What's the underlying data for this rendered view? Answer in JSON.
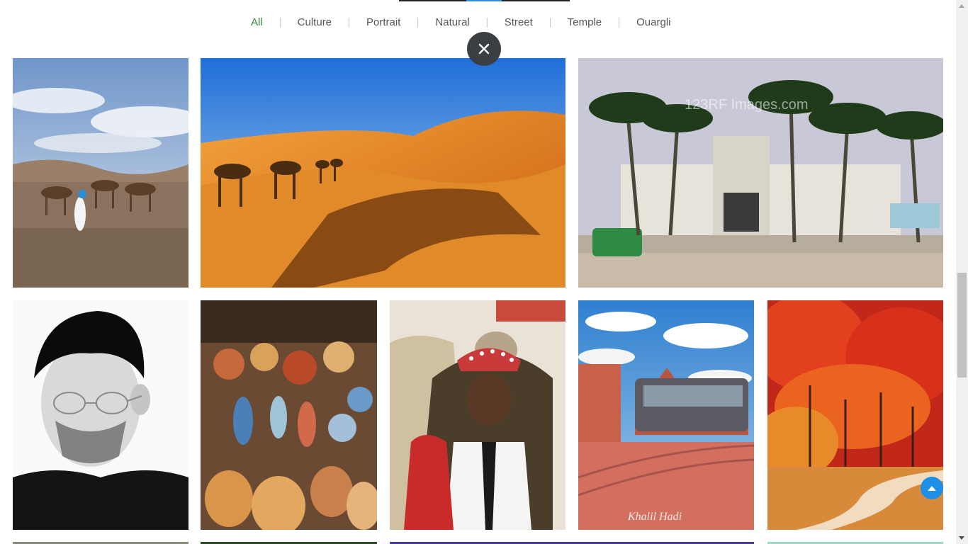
{
  "filters": [
    {
      "label": "All",
      "active": true
    },
    {
      "label": "Culture",
      "active": false
    },
    {
      "label": "Portrait",
      "active": false
    },
    {
      "label": "Natural",
      "active": false
    },
    {
      "label": "Street",
      "active": false
    },
    {
      "label": "Temple",
      "active": false
    },
    {
      "label": "Ouargli",
      "active": false
    }
  ],
  "icons": {
    "close": "close-icon",
    "back_to_top": "arrow-up-icon"
  },
  "colors": {
    "active_filter": "#2e8b3a",
    "filter_text": "#555555",
    "close_button": "#3a3f44",
    "back_to_top": "#1e8fe6",
    "top_rule_accent": "#2f8fe8"
  },
  "watermark": "123RF Images.com",
  "signature": "Khalil Hadi"
}
